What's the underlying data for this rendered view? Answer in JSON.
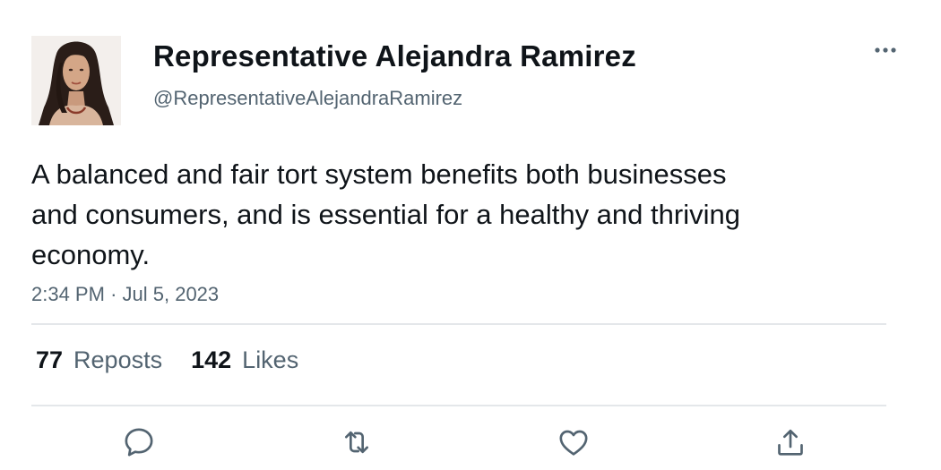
{
  "author": {
    "display_name": "Representative Alejandra Ramirez",
    "handle": "@RepresentativeAlejandraRamirez",
    "avatar_icon": "profile-photo"
  },
  "tweet": {
    "text": "A balanced and fair tort system benefits both businesses and consumers, and is essential for a healthy and thriving economy.",
    "time": "2:34 PM",
    "separator": "·",
    "date": "Jul 5, 2023"
  },
  "stats": {
    "reposts_count": "77",
    "reposts_label": "Reposts",
    "likes_count": "142",
    "likes_label": "Likes"
  },
  "actions": {
    "icons": [
      "reply-icon",
      "repost-icon",
      "like-icon",
      "share-icon"
    ]
  },
  "colors": {
    "text_primary": "#0f1419",
    "text_secondary": "#536471",
    "divider": "#e4e7ea",
    "icon": "#536471"
  }
}
